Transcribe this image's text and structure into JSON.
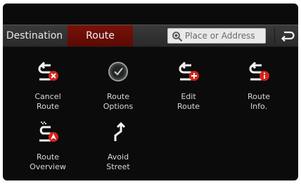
{
  "tabs": {
    "destination_label": "Destination",
    "route_label": "Route"
  },
  "search": {
    "placeholder": "Place or Address"
  },
  "buttons": [
    {
      "label": "Cancel\nRoute",
      "icon": "cancel-route-icon"
    },
    {
      "label": "Route\nOptions",
      "icon": "route-options-icon"
    },
    {
      "label": "Edit\nRoute",
      "icon": "edit-route-icon"
    },
    {
      "label": "Route\nInfo.",
      "icon": "route-info-icon"
    },
    {
      "label": "Route\nOverview",
      "icon": "route-overview-icon"
    },
    {
      "label": "Avoid\nStreet",
      "icon": "avoid-street-icon"
    }
  ],
  "colors": {
    "active_tab": "#6a0e06",
    "badge_red": "#d4221a",
    "background": "#0b0b0b"
  }
}
